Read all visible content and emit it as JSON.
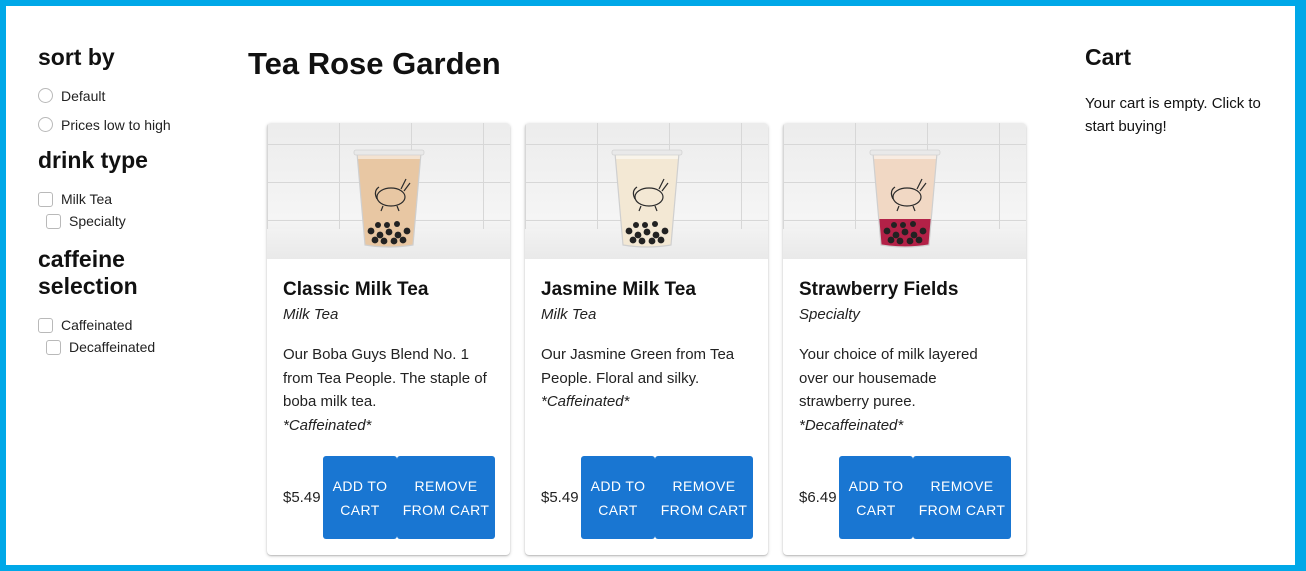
{
  "sidebar": {
    "sort": {
      "heading": "sort by",
      "options": [
        "Default",
        "Prices low to high"
      ]
    },
    "drink_type": {
      "heading": "drink type",
      "options": [
        "Milk Tea",
        "Specialty"
      ]
    },
    "caffeine": {
      "heading": "caffeine selection",
      "options": [
        "Caffeinated",
        "Decaffeinated"
      ]
    }
  },
  "main": {
    "title": "Tea Rose Garden",
    "products": [
      {
        "name": "Classic Milk Tea",
        "type": "Milk Tea",
        "description": "Our Boba Guys Blend No. 1 from Tea People. The staple of boba milk tea.",
        "caffeine": "*Caffeinated*",
        "price": "$5.49",
        "add_label": "ADD TO CART",
        "remove_label": "REMOVE FROM CART",
        "tea_color": "#e8c7a3",
        "syrup_color": ""
      },
      {
        "name": "Jasmine Milk Tea",
        "type": "Milk Tea",
        "description": "Our Jasmine Green from Tea People. Floral and silky.",
        "caffeine": "*Caffeinated*",
        "price": "$5.49",
        "add_label": "ADD TO CART",
        "remove_label": "REMOVE FROM CART",
        "tea_color": "#f3e8d4",
        "syrup_color": ""
      },
      {
        "name": "Strawberry Fields",
        "type": "Specialty",
        "description": "Your choice of milk layered over our housemade strawberry puree.",
        "caffeine": "*Decaffeinated*",
        "price": "$6.49",
        "add_label": "ADD TO CART",
        "remove_label": "REMOVE FROM CART",
        "tea_color": "#f1d8c4",
        "syrup_color": "#b32147"
      }
    ]
  },
  "cart": {
    "title": "Cart",
    "message": "Your cart is empty. Click to start buying!"
  },
  "colors": {
    "frame_border": "#00a8e8",
    "button_bg": "#1976d2"
  }
}
